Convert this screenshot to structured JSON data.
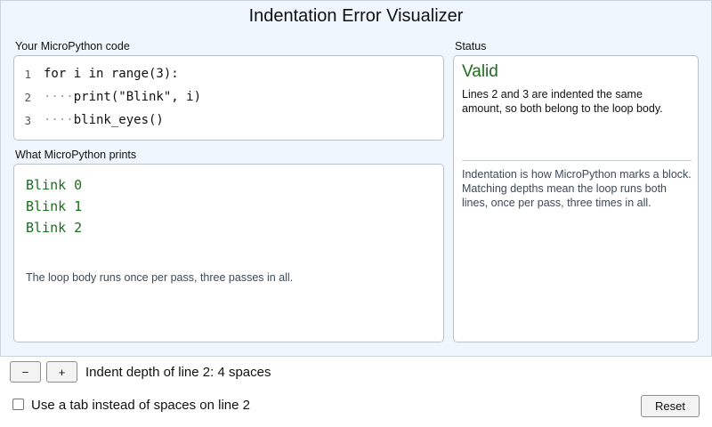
{
  "app": {
    "title": "Indentation Error Visualizer"
  },
  "code": {
    "label": "Your MicroPython code",
    "lines": [
      {
        "number": "1",
        "indent": "",
        "text": "for i in range(3):"
      },
      {
        "number": "2",
        "indent": "····",
        "text": "print(\"Blink\", i)"
      },
      {
        "number": "3",
        "indent": "····",
        "text": "blink_eyes()"
      }
    ]
  },
  "output": {
    "label": "What MicroPython prints",
    "lines": [
      "Blink 0",
      "Blink 1",
      "Blink 2"
    ],
    "note": "The loop body runs once per pass, three passes in all."
  },
  "status": {
    "label": "Status",
    "heading": "Valid",
    "message": "Lines 2 and 3 are indented the same amount, so both belong to the loop body.",
    "explanation": "Indentation is how MicroPython marks a block. Matching depths mean the loop runs both lines, once per pass, three times in all.",
    "color": "#1e6b1e"
  },
  "controls": {
    "minus_label": "−",
    "plus_label": "+",
    "depth_text": "Indent depth of line 2: 4 spaces",
    "tab_checkbox_label": "Use a tab instead of spaces on line 2",
    "tab_checked": false,
    "reset_label": "Reset"
  }
}
